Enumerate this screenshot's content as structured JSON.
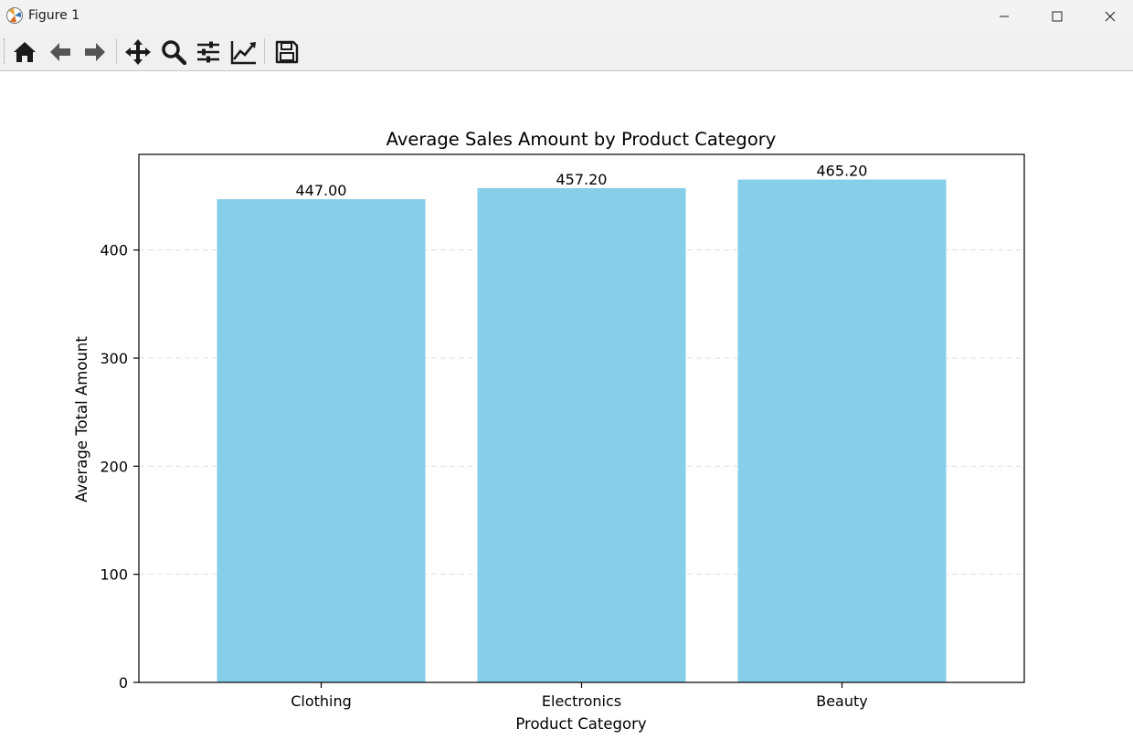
{
  "window": {
    "title": "Figure 1",
    "app_icon": "matplotlib-icon",
    "controls": [
      "minimize-icon",
      "maximize-icon",
      "close-icon"
    ]
  },
  "toolbar": {
    "buttons": [
      "home-icon",
      "back-arrow-icon",
      "forward-arrow-icon",
      "pan-move-icon",
      "zoom-magnifier-icon",
      "configure-subplots-icon",
      "edit-axis-icon",
      "save-disk-icon"
    ]
  },
  "colors": {
    "bar": "#87ceeb",
    "grid": "#e0e0e0",
    "toolbar_icon": "#1a1a1a"
  },
  "chart_data": {
    "type": "bar",
    "title": "Average Sales Amount by Product Category",
    "xlabel": "Product Category",
    "ylabel": "Average Total Amount",
    "categories": [
      "Clothing",
      "Electronics",
      "Beauty"
    ],
    "values": [
      447.0,
      457.2,
      465.2
    ],
    "value_labels": [
      "447.00",
      "457.20",
      "465.20"
    ],
    "ylim": [
      0,
      488.46
    ],
    "yticks": [
      0,
      100,
      200,
      300,
      400
    ],
    "ytick_labels": [
      "0",
      "100",
      "200",
      "300",
      "400"
    ],
    "grid": "y-axis, dashed",
    "legend": "none"
  }
}
